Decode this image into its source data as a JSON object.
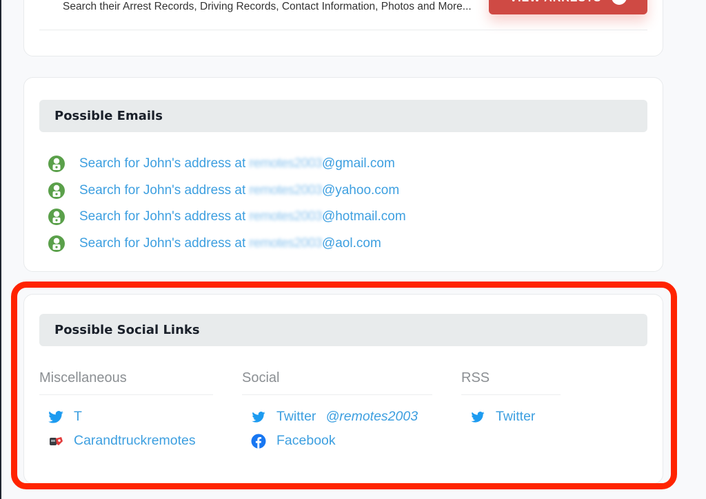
{
  "top_card": {
    "description": "Search their Arrest Records, Driving Records, Contact Information, Photos and More...",
    "button_label": "VIEW ARRESTS",
    "button_color": "#cf4a44"
  },
  "emails": {
    "title": "Possible Emails",
    "items": [
      {
        "prefix": "Search for John's address at ",
        "redacted": "remotes2003",
        "domain": "@gmail.com"
      },
      {
        "prefix": "Search for John's address at ",
        "redacted": "remotes2003",
        "domain": "@yahoo.com"
      },
      {
        "prefix": "Search for John's address at ",
        "redacted": "remotes2003",
        "domain": "@hotmail.com"
      },
      {
        "prefix": "Search for John's address at ",
        "redacted": "remotes2003",
        "domain": "@aol.com"
      }
    ]
  },
  "social": {
    "title": "Possible Social Links",
    "columns": [
      {
        "title": "Miscellaneous",
        "items": [
          {
            "icon": "twitter-icon",
            "label": "T"
          },
          {
            "icon": "site-favicon-icon",
            "label": "Carandtruckremotes"
          }
        ]
      },
      {
        "title": "Social",
        "items": [
          {
            "icon": "twitter-icon",
            "label": "Twitter",
            "handle": "@remotes2003"
          },
          {
            "icon": "facebook-icon",
            "label": "Facebook"
          }
        ]
      },
      {
        "title": "RSS",
        "items": [
          {
            "icon": "twitter-icon",
            "label": "Twitter"
          }
        ]
      }
    ]
  },
  "colors": {
    "link": "#3d9fe0",
    "email_icon": "#5aa04a",
    "annotation": "#ff2400"
  }
}
